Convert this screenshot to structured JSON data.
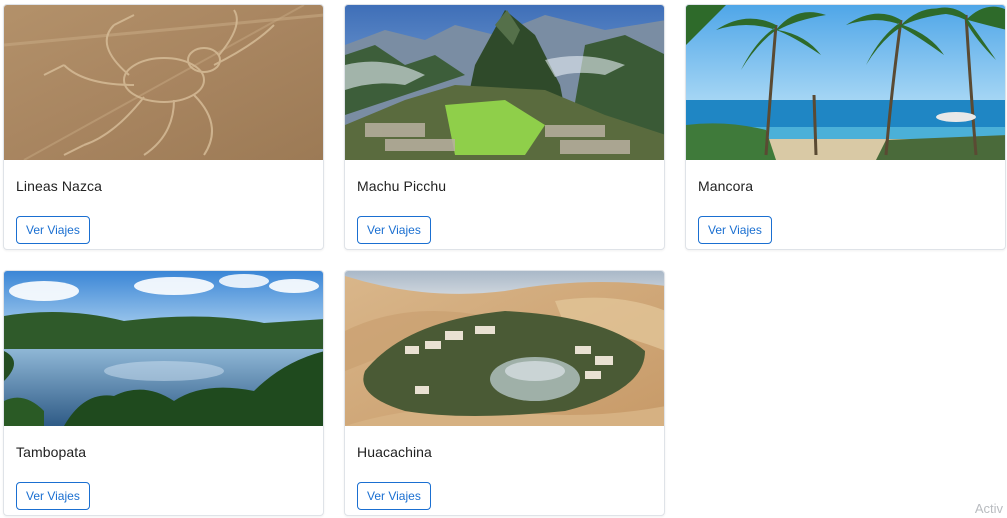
{
  "destinations": [
    {
      "title": "Lineas Nazca",
      "button": "Ver Viajes",
      "image": "nazca-lines-photo"
    },
    {
      "title": "Machu Picchu",
      "button": "Ver Viajes",
      "image": "machu-picchu-photo"
    },
    {
      "title": "Mancora",
      "button": "Ver Viajes",
      "image": "mancora-beach-photo"
    },
    {
      "title": "Tambopata",
      "button": "Ver Viajes",
      "image": "tambopata-river-photo"
    },
    {
      "title": "Huacachina",
      "button": "Ver Viajes",
      "image": "huacachina-oasis-photo"
    }
  ],
  "watermark": "Activ",
  "colors": {
    "button_text": "#1a6fd1",
    "button_border": "#1a6fd1",
    "card_border": "#dfe3e8"
  }
}
